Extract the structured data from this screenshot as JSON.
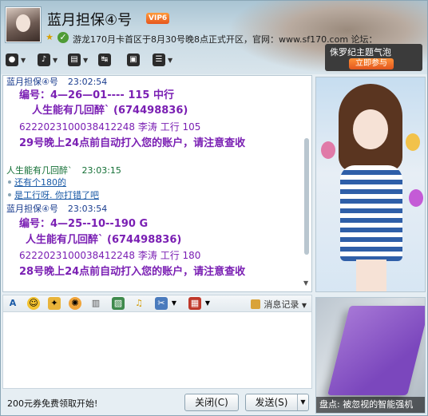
{
  "header": {
    "title": "蓝月担保④号",
    "vip_label": "VIP6",
    "signature": "游龙170月卡首区于8月30号晚8点正式开区，官网：www.sf170.com 论坛：",
    "ad": {
      "title": "侏罗纪主题气泡",
      "cta": "立即参与"
    }
  },
  "toolbar": {
    "icons": [
      "video-icon",
      "voice-icon",
      "file-transfer-icon",
      "remote-assist-icon",
      "screen-share-icon",
      "apps-icon"
    ]
  },
  "chat": {
    "messages": [
      {
        "sender": "蓝月担保④号",
        "time": "23:02:54",
        "lines": [
          "编号：4—26—01---- 115  中行",
          "人生能有几回醉`  (674498836)",
          "6222023100038412248      李涛    工行      105",
          "29号晚上24点前自动打入您的账户，请注意查收"
        ]
      },
      {
        "sender": "人生能有几回醉`",
        "time": "23:03:15",
        "links": [
          "还有个180的",
          "是工行呀. 你打错了吧"
        ]
      },
      {
        "sender": "蓝月担保④号",
        "time": "23:03:54",
        "lines": [
          "编号：4—25--10--190 G",
          "人生能有几回醉`  (674498836)",
          "6222023100038412248      李涛    工行      180",
          "28号晚上24点前自动打入您的账户，请注意查收"
        ]
      }
    ]
  },
  "side": {
    "bottom_caption": "盘点: 被忽视的智能强机"
  },
  "input_toolbar": {
    "history_label": "消息记录"
  },
  "footer": {
    "promo": "200元券免费领取开始!",
    "close_label": "关闭(C)",
    "send_label": "发送(S)"
  },
  "colors": {
    "message_text": "#7a1fb3",
    "sender_blue": "#1a3d8f",
    "sender_green": "#136f35",
    "link": "#1a5aa6"
  }
}
